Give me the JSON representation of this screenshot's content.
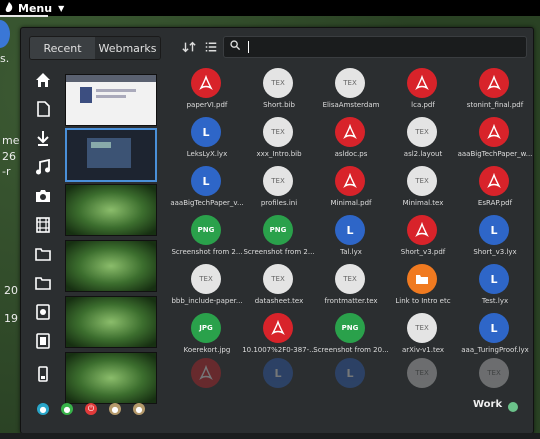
{
  "top_panel": {
    "menu_label": "Menu"
  },
  "desktop": {
    "fragments": [
      "s.",
      "me",
      "26",
      "-r",
      "20",
      "19"
    ]
  },
  "tabs": [
    "Recent",
    "Webmarks"
  ],
  "search": {
    "value": "",
    "placeholder": ""
  },
  "sidebar": [
    {
      "name": "home-icon"
    },
    {
      "name": "document-icon"
    },
    {
      "name": "download-icon"
    },
    {
      "name": "music-icon"
    },
    {
      "name": "camera-icon"
    },
    {
      "name": "film-icon"
    },
    {
      "name": "folder-icon"
    },
    {
      "name": "folder-icon"
    },
    {
      "name": "document-icon"
    },
    {
      "name": "archive-icon"
    },
    {
      "name": "phone-icon"
    }
  ],
  "session_buttons": [
    "lock",
    "suspend",
    "shutdown",
    "user",
    "settings"
  ],
  "work_label": "Work",
  "files": [
    {
      "name": "paperVI.pdf",
      "type": "pdf"
    },
    {
      "name": "Short.bib",
      "type": "tex"
    },
    {
      "name": "ElisaAmsterdam",
      "type": "tex"
    },
    {
      "name": "lca.pdf",
      "type": "pdf"
    },
    {
      "name": "stonint_final.pdf",
      "type": "pdf"
    },
    {
      "name": "LeksLyX.lyx",
      "type": "lyx"
    },
    {
      "name": "xxx_Intro.bib",
      "type": "tex"
    },
    {
      "name": "asldoc.ps",
      "type": "ps"
    },
    {
      "name": "asl2.layout",
      "type": "tex"
    },
    {
      "name": "aaaBigTechPaper_w...",
      "type": "pdf"
    },
    {
      "name": "aaaBigTechPaper_v...",
      "type": "lyx"
    },
    {
      "name": "profiles.ini",
      "type": "tex"
    },
    {
      "name": "Minimal.pdf",
      "type": "pdf"
    },
    {
      "name": "Minimal.tex",
      "type": "tex"
    },
    {
      "name": "EsRAP.pdf",
      "type": "pdf"
    },
    {
      "name": "Screenshot from 2...",
      "type": "png"
    },
    {
      "name": "Screenshot from 2...",
      "type": "png"
    },
    {
      "name": "Tal.lyx",
      "type": "lyx"
    },
    {
      "name": "Short_v3.pdf",
      "type": "pdf"
    },
    {
      "name": "Short_v3.lyx",
      "type": "lyx"
    },
    {
      "name": "bbb_include-paper...",
      "type": "tex"
    },
    {
      "name": "datasheet.tex",
      "type": "tex"
    },
    {
      "name": "frontmatter.tex",
      "type": "tex"
    },
    {
      "name": "Link to Intro etc",
      "type": "folder"
    },
    {
      "name": "Test.lyx",
      "type": "lyx"
    },
    {
      "name": "Koerekort.jpg",
      "type": "jpg"
    },
    {
      "name": "10.1007%2F0-387-...",
      "type": "pdf"
    },
    {
      "name": "Screenshot from 20...",
      "type": "png"
    },
    {
      "name": "arXiv-v1.tex",
      "type": "tex"
    },
    {
      "name": "aaa_TuringProof.lyx",
      "type": "lyx"
    },
    {
      "name": "",
      "type": "pdf"
    },
    {
      "name": "",
      "type": "lyx"
    },
    {
      "name": "",
      "type": "lyx"
    },
    {
      "name": "",
      "type": "tex"
    },
    {
      "name": "",
      "type": "tex"
    }
  ]
}
